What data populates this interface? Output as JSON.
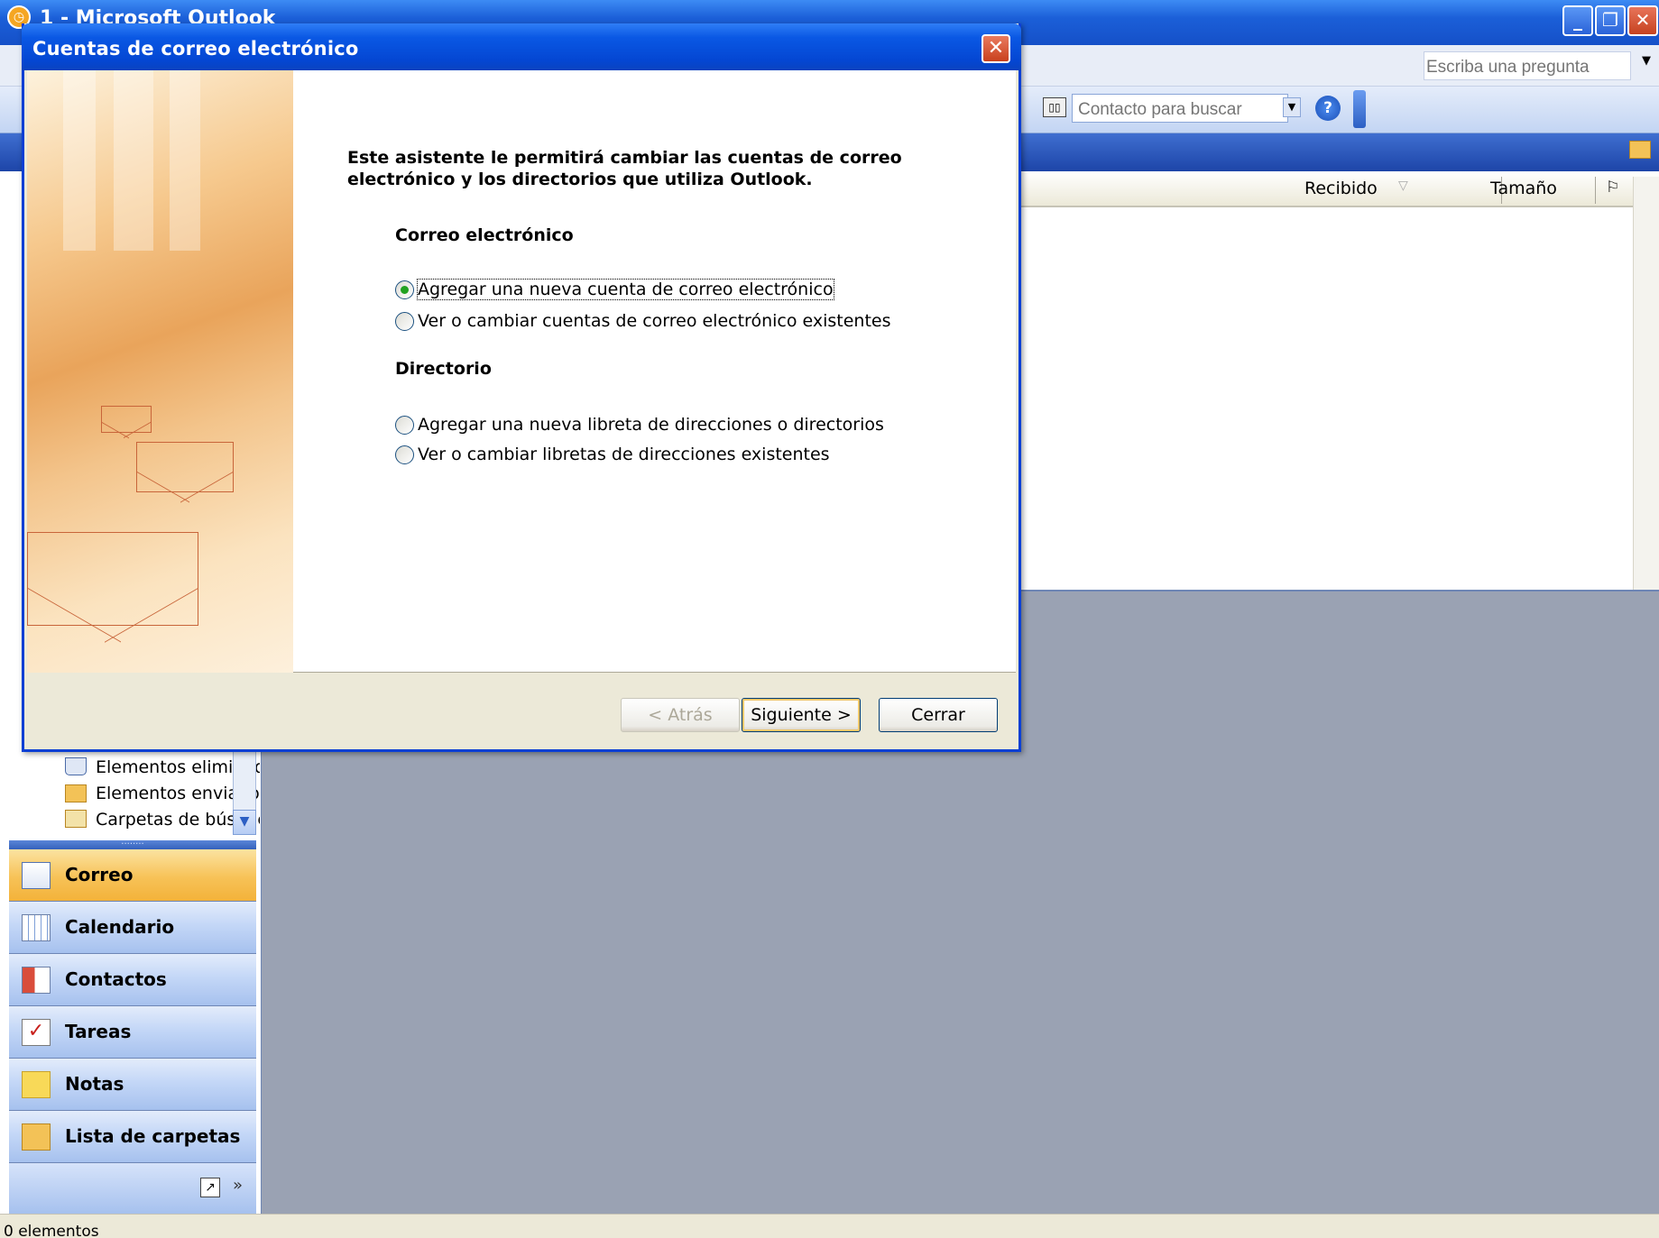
{
  "app": {
    "title": "1 - Microsoft Outlook",
    "ask_question_placeholder": "Escriba una pregunta",
    "contact_search_placeholder": "Contacto para buscar"
  },
  "message_list": {
    "columns": [
      "Recibido",
      "Tamaño"
    ]
  },
  "folders": [
    {
      "label": "Elementos eliminados",
      "icon": "trash-icon"
    },
    {
      "label": "Elementos enviados",
      "icon": "folder-icon"
    },
    {
      "label": "Carpetas de búsqueda",
      "icon": "search-folder-icon"
    }
  ],
  "nav_buttons": [
    {
      "label": "Correo",
      "icon": "mail-icon",
      "active": true
    },
    {
      "label": "Calendario",
      "icon": "calendar-icon",
      "active": false
    },
    {
      "label": "Contactos",
      "icon": "contacts-icon",
      "active": false
    },
    {
      "label": "Tareas",
      "icon": "tasks-icon",
      "active": false
    },
    {
      "label": "Notas",
      "icon": "notes-icon",
      "active": false
    },
    {
      "label": "Lista de carpetas",
      "icon": "folder-list-icon",
      "active": false
    }
  ],
  "status": {
    "items_text": "0 elementos"
  },
  "dialog": {
    "title": "Cuentas de correo electrónico",
    "intro": "Este asistente le permitirá cambiar las cuentas de correo electrónico y los directorios que utiliza Outlook.",
    "email_section": {
      "heading": "Correo electrónico",
      "options": [
        {
          "label": "Agregar una nueva cuenta de correo electrónico",
          "checked": true
        },
        {
          "label": "Ver o cambiar cuentas de correo electrónico existentes",
          "checked": false
        }
      ]
    },
    "directory_section": {
      "heading": "Directorio",
      "options": [
        {
          "label": "Agregar una nueva libreta de direcciones o directorios",
          "checked": false
        },
        {
          "label": "Ver o cambiar libretas de direcciones existentes",
          "checked": false
        }
      ]
    },
    "buttons": {
      "back": "< Atrás",
      "next": "Siguiente >",
      "close": "Cerrar"
    }
  },
  "colors": {
    "titlebar_blue": "#0a58e4",
    "nav_active": "#f7c257",
    "reading_pane": "#9aa2b3"
  }
}
